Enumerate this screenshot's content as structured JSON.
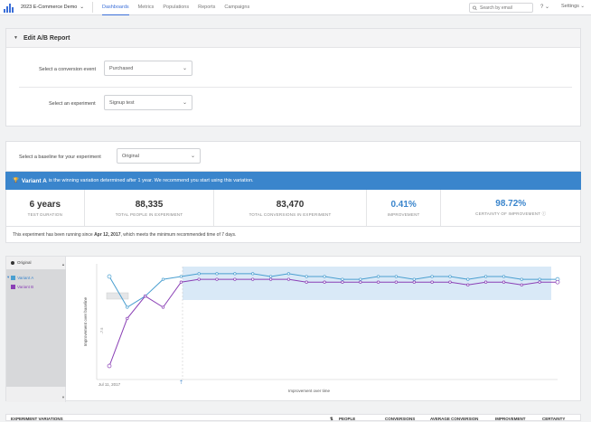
{
  "header": {
    "project": "2023 E-Commerce Demo",
    "nav": [
      "Dashboards",
      "Metrics",
      "Populations",
      "Reports",
      "Campaigns"
    ],
    "active_nav": "Dashboards",
    "search_placeholder": "Search by email",
    "help": "?",
    "settings": "Settings"
  },
  "ab_report": {
    "title": "Edit A/B Report",
    "conversion_label": "Select a conversion event",
    "conversion_value": "Purchased",
    "experiment_label": "Select an experiment",
    "experiment_value": "Signup test"
  },
  "baseline": {
    "label": "Select a baseline for your experiment",
    "value": "Original"
  },
  "winner_banner": {
    "variant": "Variant A",
    "text": "is the winning variation determined after 1 year. We recommend you start using this variation."
  },
  "stats": [
    {
      "value": "6 years",
      "label": "TEST DURATION"
    },
    {
      "value": "88,335",
      "label": "TOTAL PEOPLE IN EXPERIMENT"
    },
    {
      "value": "83,470",
      "label": "TOTAL CONVERSIONS IN EXPERIMENT"
    },
    {
      "value": "0.41%",
      "label": "IMPROVEMENT"
    },
    {
      "value": "98.72%",
      "label": "CERTAINTY OF IMPROVEMENT"
    }
  ],
  "note": {
    "prefix": "This experiment has been running since",
    "date": "Apr 12, 2017",
    "suffix": ", which meets the minimum recommended time of 7 days."
  },
  "legend": {
    "original": "Original",
    "variant_a": "Variant A",
    "variant_b": "Variant B"
  },
  "colors": {
    "variant_a": "#4a9fd0",
    "variant_b": "#8a3fb5",
    "banner": "#3a85cc",
    "accent": "#3b6fd8"
  },
  "chart_data": {
    "type": "line",
    "ylabel": "Improvement over baseline",
    "xlabel": "Improvement over time",
    "x_tick": "Jul 11, 2017",
    "y_tick": "-7.5",
    "series": [
      {
        "name": "Variant A",
        "values": [
          2,
          -9,
          -5,
          1,
          2,
          3,
          3,
          3,
          3,
          2,
          3,
          2,
          2,
          1,
          1,
          2,
          2,
          1,
          2,
          2,
          1,
          2,
          2,
          1,
          1,
          1
        ]
      },
      {
        "name": "Variant B",
        "values": [
          -30,
          -13,
          -5,
          -9,
          0,
          1,
          1,
          1,
          1,
          1,
          1,
          0,
          0,
          0,
          0,
          0,
          0,
          0,
          0,
          0,
          -1,
          0,
          0,
          -1,
          0,
          0
        ]
      }
    ],
    "grid": true,
    "legend": "left"
  },
  "table": {
    "columns": [
      "EXPERIMENT VARIATIONS",
      "PEOPLE",
      "CONVERSIONS",
      "AVERAGE CONVERSION",
      "IMPROVEMENT",
      "CERTAINTY"
    ]
  }
}
